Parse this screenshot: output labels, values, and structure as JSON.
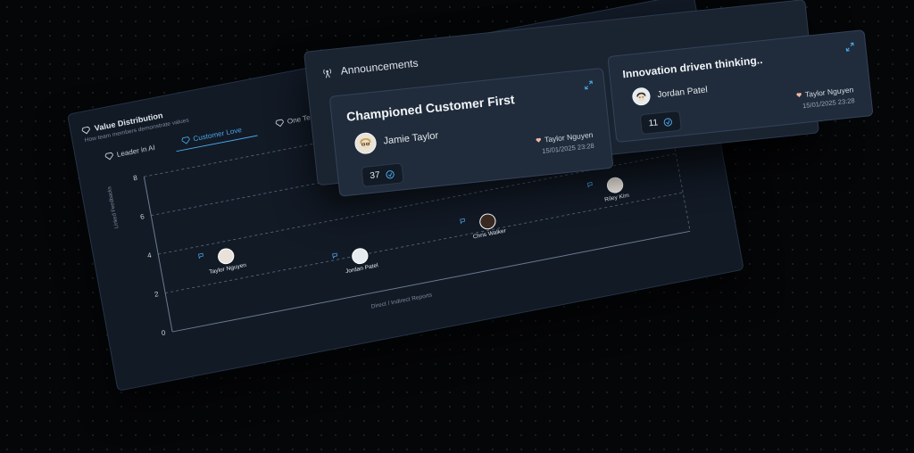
{
  "value_distribution": {
    "title": "Value Distribution",
    "subtitle": "How team members demonstrate values",
    "tabs": [
      {
        "label": "Leader in AI",
        "active": false
      },
      {
        "label": "Customer Love",
        "active": true
      },
      {
        "label": "One Team",
        "active": false
      }
    ],
    "chart_data": {
      "type": "scatter",
      "ylabel": "Linked Feedbacks",
      "xlabel": "Direct / Indirect Reports",
      "ylim": [
        0,
        8
      ],
      "yticks": [
        "0",
        "2",
        "4",
        "6",
        "8"
      ],
      "grid": true,
      "points": [
        {
          "name": "Taylor Nguyen",
          "y": 3.2
        },
        {
          "name": "Jordan Patel",
          "y": 1.9
        },
        {
          "name": "Chris Walker",
          "y": 2.4
        },
        {
          "name": "Riley Kim",
          "y": 3.0
        }
      ]
    }
  },
  "announcements": {
    "title": "Announcements",
    "cards": [
      {
        "title": "Championed Customer First",
        "author": "Jamie Taylor",
        "posted_by": "Taylor Nguyen",
        "date": "15/01/2025 23:28",
        "count": "37"
      },
      {
        "title": "Innovation driven thinking..",
        "author": "Jordan Patel",
        "posted_by": "Taylor Nguyen",
        "date": "15/01/2025 23:28",
        "count": "11"
      }
    ]
  },
  "colors": {
    "accent": "#4aa6e8",
    "background": "#050608",
    "panel": "#121a26"
  },
  "icons": [
    "gem-icon",
    "broadcast-icon",
    "expand-icon",
    "clap-icon",
    "heart-icon",
    "message-icon"
  ]
}
